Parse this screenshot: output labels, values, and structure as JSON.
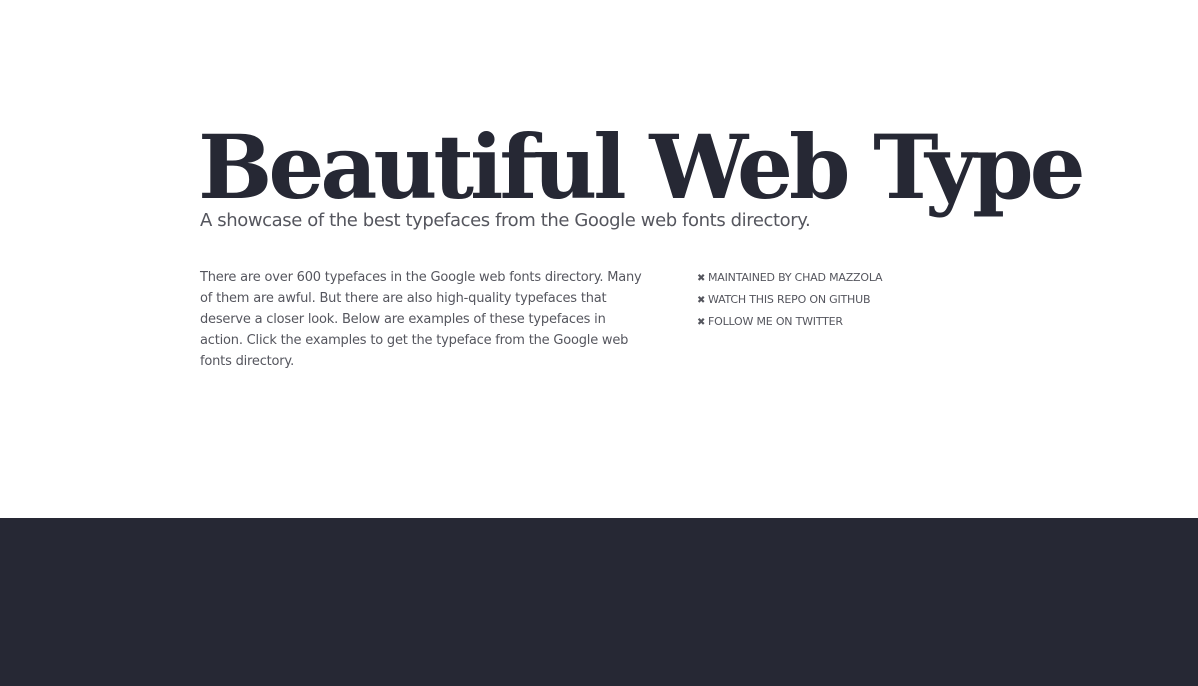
{
  "header": {
    "title": "Beautiful Web Type",
    "subtitle": "A showcase of the best typefaces from the Google web fonts directory."
  },
  "intro": {
    "text": "There are over 600 typefaces in the Google web fonts directory. Many of them are awful. But there are also high-quality typefaces that deserve a closer look. Below are examples of these typefaces in action. Click the examples to get the typeface from the Google web fonts directory."
  },
  "links": [
    {
      "icon": "x-icon",
      "label": "MAINTAINED BY CHAD MAZZOLA"
    },
    {
      "icon": "x-icon",
      "label": "WATCH THIS REPO ON GITHUB"
    },
    {
      "icon": "x-icon",
      "label": "FOLLOW ME ON TWITTER"
    }
  ],
  "colors": {
    "text_dark": "#262834",
    "text_gray": "#55565e",
    "background": "#ffffff",
    "footer_band": "#262834"
  }
}
